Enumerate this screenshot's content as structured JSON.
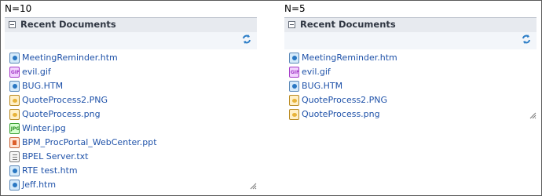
{
  "panels": [
    {
      "caption": "N=10",
      "title": "Recent Documents",
      "refresh_icon": "refresh-icon",
      "documents": [
        {
          "name": "MeetingReminder.htm",
          "icon": "htm",
          "icon_name": "web-page-icon"
        },
        {
          "name": "evil.gif",
          "icon": "gif",
          "icon_name": "gif-file-icon",
          "badge": "GIF"
        },
        {
          "name": "BUG.HTM",
          "icon": "htm",
          "icon_name": "web-page-icon"
        },
        {
          "name": "QuoteProcess2.PNG",
          "icon": "png",
          "icon_name": "png-file-icon"
        },
        {
          "name": "QuoteProcess.png",
          "icon": "png",
          "icon_name": "png-file-icon"
        },
        {
          "name": "Winter.jpg",
          "icon": "jpg",
          "icon_name": "jpg-file-icon",
          "badge": "JPG"
        },
        {
          "name": "BPM_ProcPortal_WebCenter.ppt",
          "icon": "ppt",
          "icon_name": "presentation-file-icon"
        },
        {
          "name": "BPEL Server.txt",
          "icon": "txt",
          "icon_name": "text-file-icon"
        },
        {
          "name": "RTE test.htm",
          "icon": "htm",
          "icon_name": "web-page-icon"
        },
        {
          "name": "Jeff.htm",
          "icon": "htm",
          "icon_name": "web-page-icon"
        }
      ]
    },
    {
      "caption": "N=5",
      "title": "Recent Documents",
      "refresh_icon": "refresh-icon",
      "documents": [
        {
          "name": "MeetingReminder.htm",
          "icon": "htm",
          "icon_name": "web-page-icon"
        },
        {
          "name": "evil.gif",
          "icon": "gif",
          "icon_name": "gif-file-icon",
          "badge": "GIF"
        },
        {
          "name": "BUG.HTM",
          "icon": "htm",
          "icon_name": "web-page-icon"
        },
        {
          "name": "QuoteProcess2.PNG",
          "icon": "png",
          "icon_name": "png-file-icon"
        },
        {
          "name": "QuoteProcess.png",
          "icon": "png",
          "icon_name": "png-file-icon"
        }
      ]
    }
  ],
  "colors": {
    "link": "#1f52a9",
    "header_bg": "#e7eaef",
    "toolbar_bg": "#f3f6fa",
    "frame_border": "#5a5a5a"
  }
}
